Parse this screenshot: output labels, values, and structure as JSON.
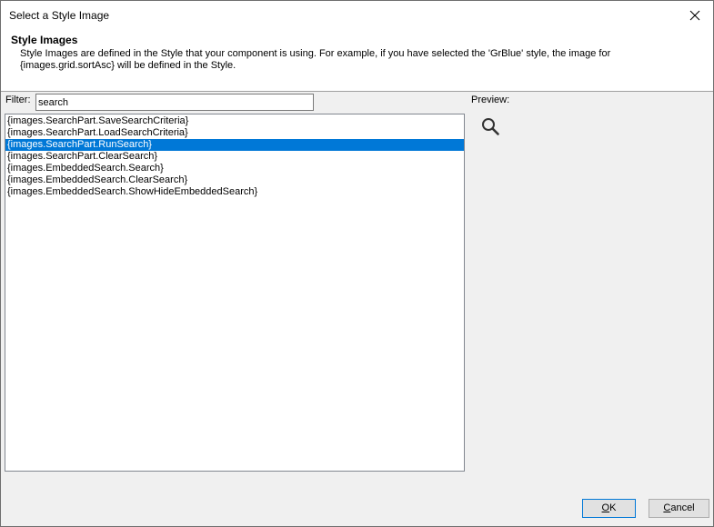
{
  "window": {
    "title": "Select a Style Image"
  },
  "header": {
    "title": "Style Images",
    "description": "Style Images are defined in the Style that your component is using. For example, if you have selected the 'GrBlue' style, the image for {images.grid.sortAsc} will be defined in the Style."
  },
  "filter": {
    "label": "Filter:",
    "value": "search"
  },
  "preview": {
    "label": "Preview:",
    "icon": "search-icon",
    "color": "#333333"
  },
  "list": {
    "selected_index": 2,
    "selection_color": "#0078d7",
    "items": [
      "{images.SearchPart.SaveSearchCriteria}",
      "{images.SearchPart.LoadSearchCriteria}",
      "{images.SearchPart.RunSearch}",
      "{images.SearchPart.ClearSearch}",
      "{images.EmbeddedSearch.Search}",
      "{images.EmbeddedSearch.ClearSearch}",
      "{images.EmbeddedSearch.ShowHideEmbeddedSearch}"
    ]
  },
  "buttons": {
    "ok_mnemonic": "O",
    "ok_rest": "K",
    "cancel_mnemonic": "C",
    "cancel_rest": "ancel"
  }
}
